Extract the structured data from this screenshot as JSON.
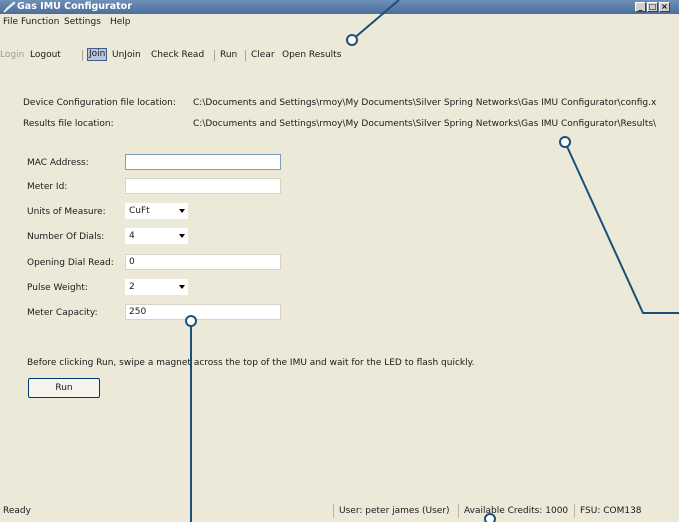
{
  "window": {
    "title": "Gas IMU Configurator",
    "controls": [
      "_",
      "□",
      "×"
    ]
  },
  "menu": [
    "File",
    "Function",
    "Settings",
    "Help"
  ],
  "toolbar": {
    "login": "Login",
    "logout": "Logout",
    "join": "Join",
    "unjoin": "UnJoin",
    "check_read": "Check Read",
    "run": "Run",
    "clear": "Clear",
    "open_results": "Open Results"
  },
  "config": {
    "device_label": "Device Configuration file location:",
    "device_path": "C:\\Documents and Settings\\rmoy\\My Documents\\Silver Spring Networks\\Gas IMU Configurator\\config.x",
    "results_label": "Results file location:",
    "results_path": "C:\\Documents and Settings\\rmoy\\My Documents\\Silver Spring Networks\\Gas IMU Configurator\\Results\\"
  },
  "form": {
    "mac_label": "MAC Address:",
    "mac_value": "",
    "meter_id_label": "Meter Id:",
    "meter_id_value": "",
    "units_label": "Units of Measure:",
    "units_value": "CuFt",
    "dials_label": "Number Of Dials:",
    "dials_value": "4",
    "opening_label": "Opening Dial Read:",
    "opening_value": "0",
    "pulse_label": "Pulse Weight:",
    "pulse_value": "2",
    "capacity_label": "Meter Capacity:",
    "capacity_value": "250"
  },
  "instructions": "Before clicking Run, swipe a magnet across the top of the IMU and wait for the LED to flash quickly.",
  "run_button": "Run",
  "status": {
    "state": "Ready",
    "user": "User: peter james (User)",
    "credits": "Available Credits: 1000",
    "fsu": "FSU: COM138"
  },
  "colors": {
    "titlebar": "#4a6d9c",
    "window_bg": "#ece9d8",
    "callout": "#1c4f78"
  }
}
